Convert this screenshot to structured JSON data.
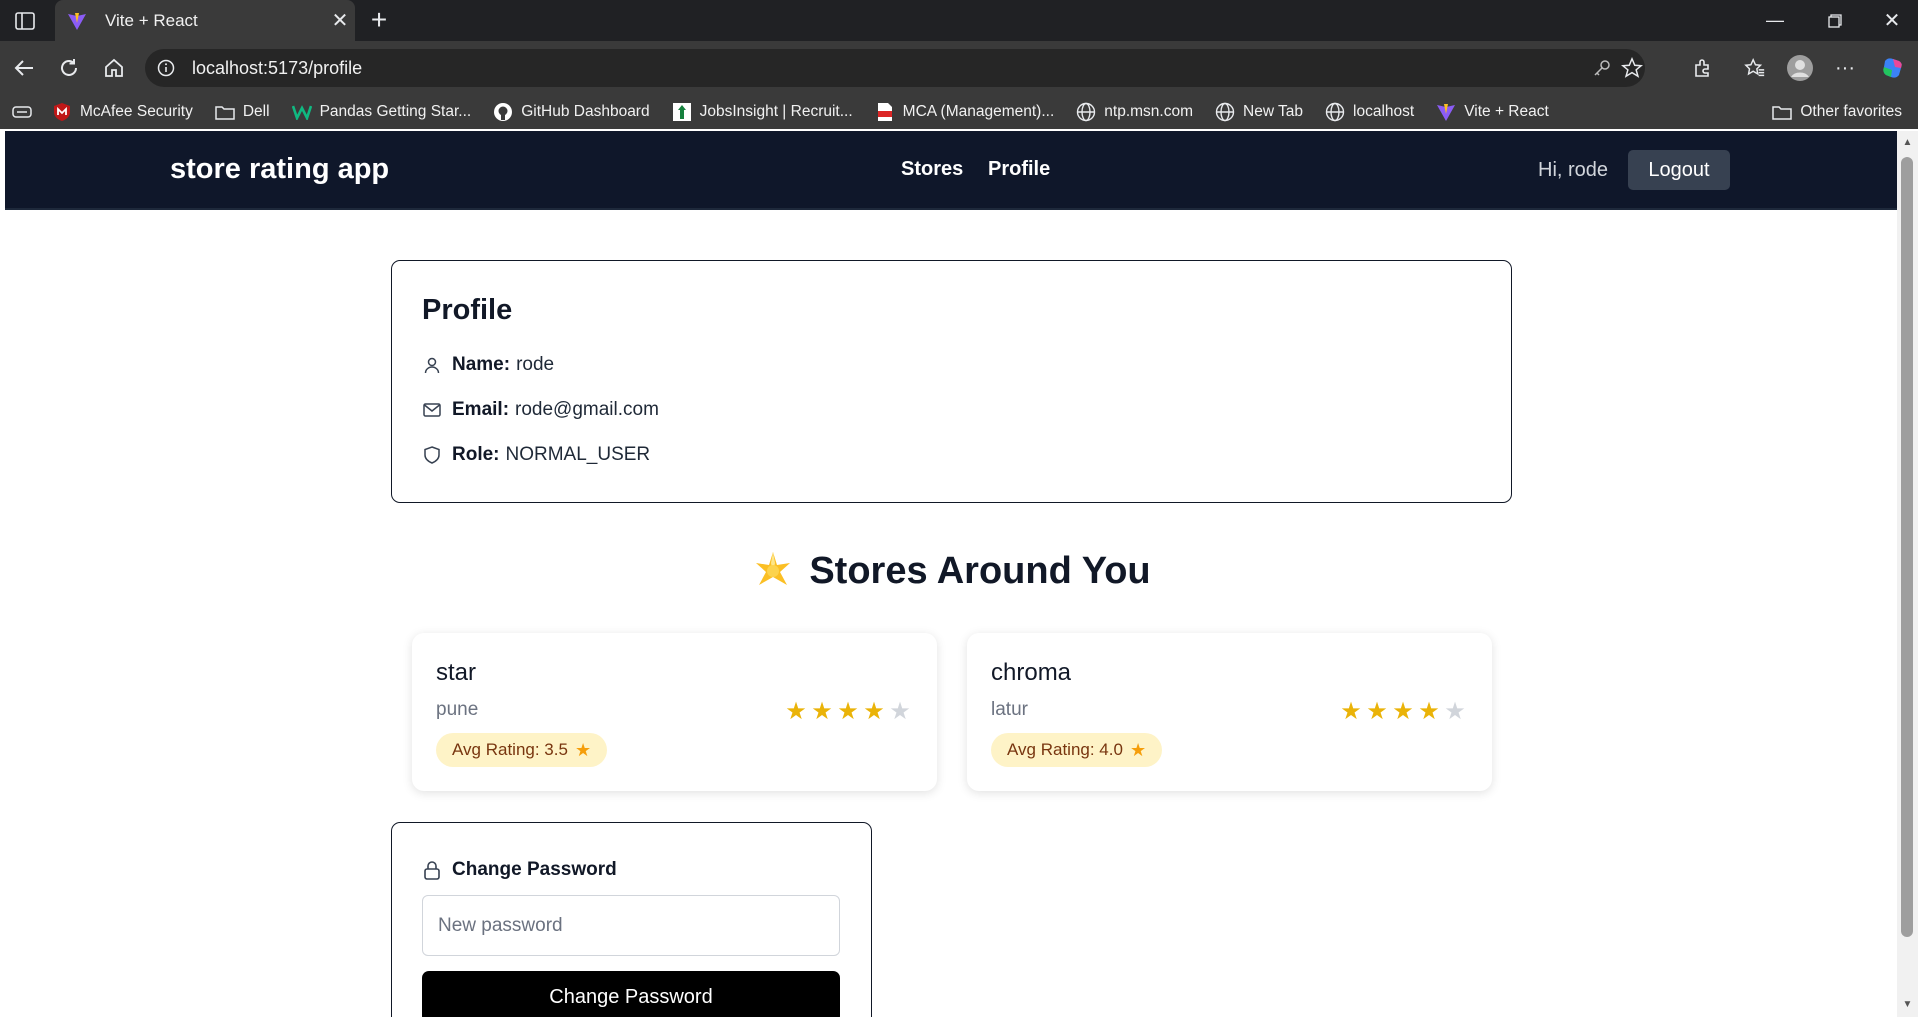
{
  "browser": {
    "tab_title": "Vite + React",
    "url": "localhost:5173/profile",
    "bookmarks": [
      {
        "label": "McAfee Security",
        "icon": "mcafee-icon"
      },
      {
        "label": "Dell",
        "icon": "folder-icon"
      },
      {
        "label": "Pandas Getting Star...",
        "icon": "w-green-icon"
      },
      {
        "label": "GitHub Dashboard",
        "icon": "github-icon"
      },
      {
        "label": "JobsInsight | Recruit...",
        "icon": "jobsinsight-icon"
      },
      {
        "label": "MCA (Management)...",
        "icon": "pdf-icon"
      },
      {
        "label": "ntp.msn.com",
        "icon": "globe-icon"
      },
      {
        "label": "New Tab",
        "icon": "globe-icon"
      },
      {
        "label": "localhost",
        "icon": "globe-icon"
      },
      {
        "label": "Vite + React",
        "icon": "vite-icon"
      }
    ],
    "other_favorites": "Other favorites"
  },
  "app": {
    "brand": "store rating app",
    "nav": {
      "stores": "Stores",
      "profile": "Profile"
    },
    "greeting": "Hi, rode",
    "logout": "Logout"
  },
  "profile": {
    "title": "Profile",
    "name_label": "Name:",
    "name": "rode",
    "email_label": "Email:",
    "email": "rode@gmail.com",
    "role_label": "Role:",
    "role": "NORMAL_USER"
  },
  "stores_section": {
    "title": "Stores Around You",
    "stores": [
      {
        "name": "star",
        "address": "pune",
        "user_rating": 4,
        "max_rating": 5,
        "avg_label": "Avg Rating: 3.5"
      },
      {
        "name": "chroma",
        "address": "latur",
        "user_rating": 4,
        "max_rating": 5,
        "avg_label": "Avg Rating: 4.0"
      }
    ]
  },
  "password": {
    "title": "Change Password",
    "placeholder": "New password",
    "button": "Change Password"
  },
  "colors": {
    "nav_bg": "#0f172a",
    "star_filled": "#eab308",
    "star_empty": "#d1d5db",
    "badge_bg": "#fef3c7"
  }
}
